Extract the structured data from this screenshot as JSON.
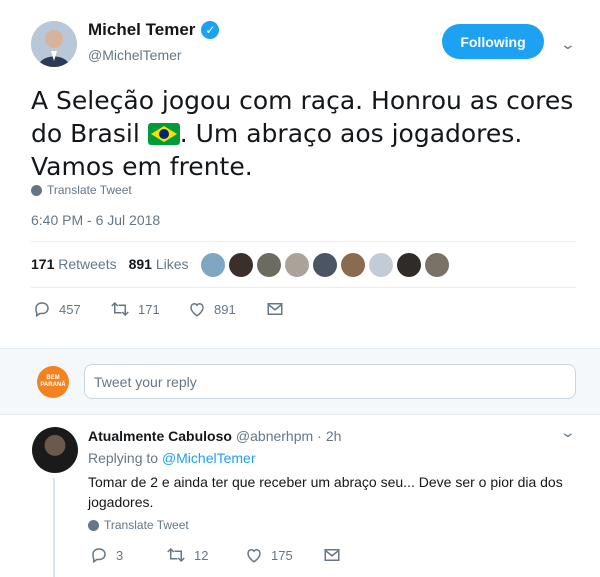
{
  "tweet": {
    "author_name": "Michel Temer",
    "author_handle": "@MichelTemer",
    "follow_label": "Following",
    "text_before_flag": "A Seleção jogou com raça. Honrou as cores do Brasil ",
    "text_after_flag": ". Um abraço aos jogadores. Vamos em frente.",
    "translate_label": "Translate Tweet",
    "timestamp": "6:40 PM - 6 Jul 2018",
    "retweets_count": "171",
    "retweets_label": "Retweets",
    "likes_count": "891",
    "likes_label": "Likes",
    "actions": {
      "replies": "457",
      "retweets": "171",
      "likes": "891"
    }
  },
  "reply_box": {
    "avatar_text": "BEM PARANÁ",
    "placeholder": "Tweet your reply"
  },
  "reply": {
    "name": "Atualmente Cabuloso",
    "handle": "@abnerhpm",
    "separator": "·",
    "time": "2h",
    "replying_prefix": "Replying to",
    "replying_to": "@MichelTemer",
    "text": "Tomar de 2 e ainda ter que receber um abraço seu... Deve ser o pior dia dos jogadores.",
    "translate_label": "Translate Tweet",
    "actions": {
      "replies": "3",
      "retweets": "12",
      "likes": "175"
    }
  },
  "colors": {
    "accent": "#1da1f2",
    "muted": "#657786",
    "brand_orange": "#f58220"
  }
}
